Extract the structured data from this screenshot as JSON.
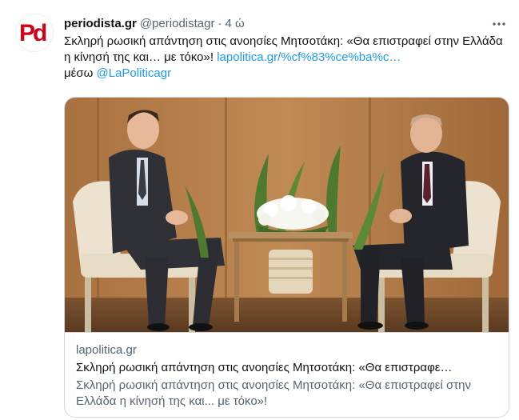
{
  "tweet": {
    "author_name": "periodista.gr",
    "author_handle": "@periodistagr",
    "separator": "·",
    "time": "4 ώ",
    "text_main": "Σκληρή ρωσική απάντηση στις ανοησίες Μητσοτάκη: «Θα επιστραφεί στην Ελλάδα η κίνησή της και… με τόκο»!",
    "link_text": "lapolitica.gr/%cf%83%ce%ba%c…",
    "via_text": "μέσω",
    "mention": "@LaPoliticagr"
  },
  "avatar": {
    "letters": "Pd",
    "color": "#d0021b"
  },
  "card": {
    "domain": "lapolitica.gr",
    "title": "Σκληρή ρωσική απάντηση στις ανοησίες Μητσοτάκη: «Θα επιστραφε…",
    "description": "Σκληρή ρωσική απάντηση στις ανοησίες Μητσοτάκη: «Θα επιστραφεί στην Ελλάδα η κίνησή της και... με τόκο»!"
  },
  "colors": {
    "accent": "#1d9bf0",
    "text": "#0f1419",
    "muted": "#536471",
    "border": "#cfd9de"
  },
  "icons": {
    "more": "more-horizontal-icon"
  }
}
